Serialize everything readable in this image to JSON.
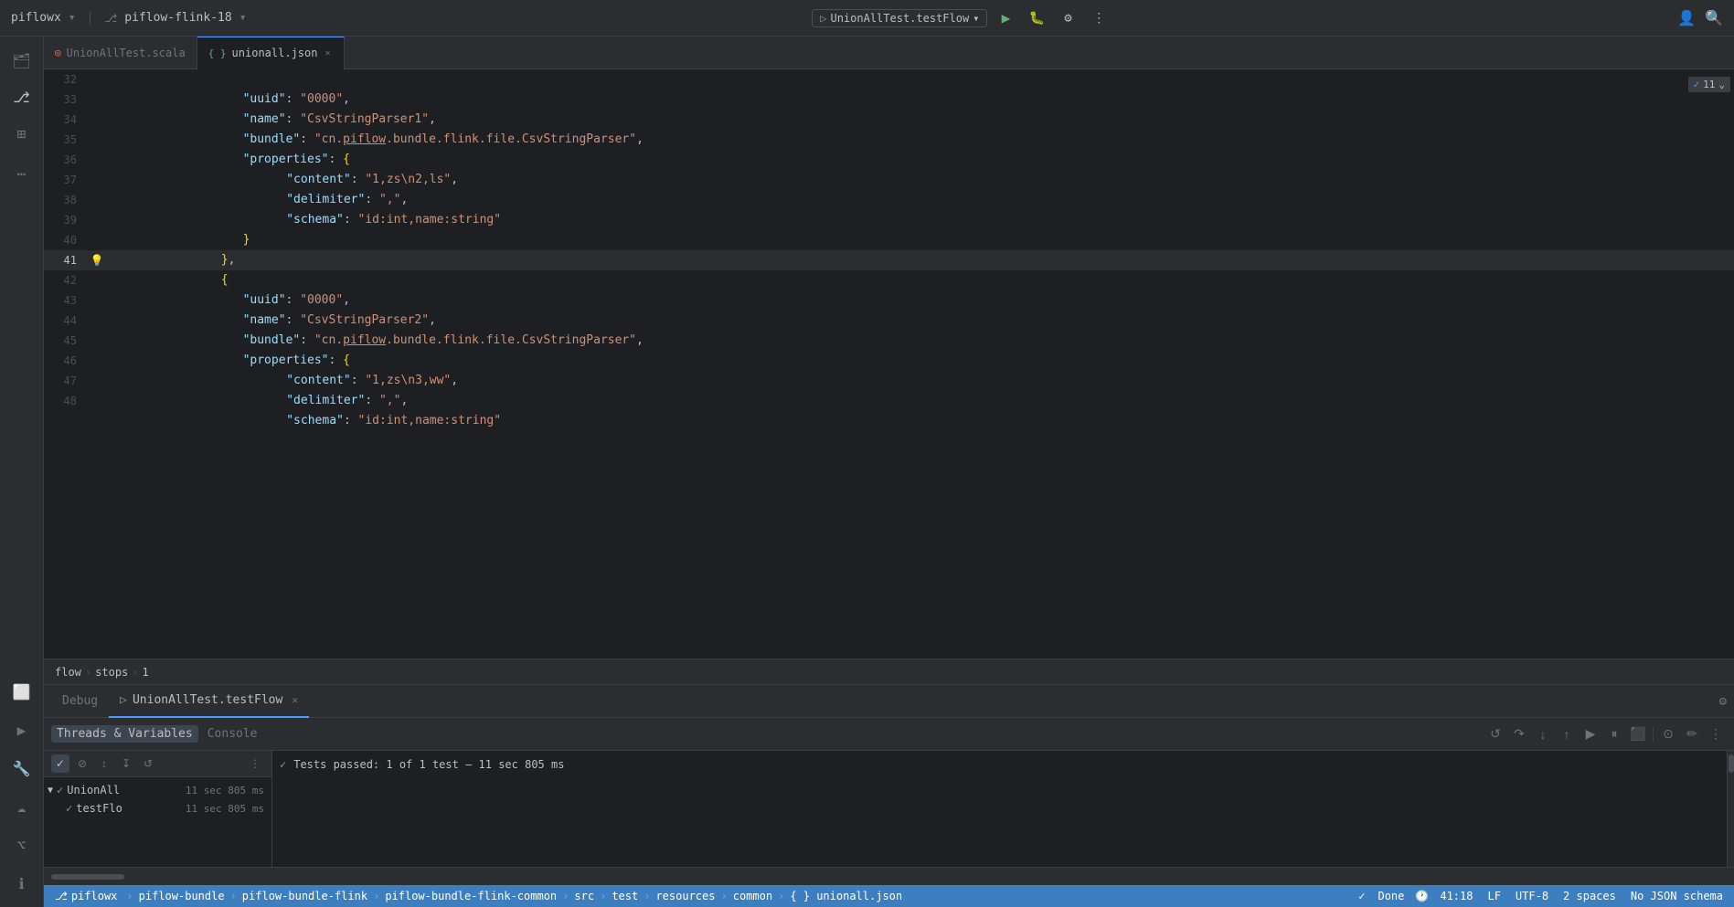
{
  "titleBar": {
    "projectName": "piflowx",
    "branchName": "piflow-flink-18",
    "runConfig": "UnionAllTest.testFlow",
    "chevron": "▾"
  },
  "tabs": [
    {
      "id": "unionalltest-scala",
      "icon": "◎",
      "label": "UnionAllTest.scala",
      "closable": false,
      "active": false
    },
    {
      "id": "unionall-json",
      "icon": "{ }",
      "label": "unionall.json",
      "closable": true,
      "active": true
    }
  ],
  "editor": {
    "scrollIndicator": "11",
    "lines": [
      {
        "num": 32,
        "gutter": "",
        "content": "  \"uuid\": \"0000\","
      },
      {
        "num": 33,
        "gutter": "",
        "content": "  \"name\": \"CsvStringParser1\","
      },
      {
        "num": 34,
        "gutter": "",
        "content": "  \"bundle\": \"cn.piflow.bundle.flink.file.CsvStringParser\","
      },
      {
        "num": 35,
        "gutter": "",
        "content": "  \"properties\": {"
      },
      {
        "num": 36,
        "gutter": "",
        "content": "    \"content\": \"1,zs\\n2,ls\","
      },
      {
        "num": 37,
        "gutter": "",
        "content": "    \"delimiter\": \",\","
      },
      {
        "num": 38,
        "gutter": "",
        "content": "    \"schema\": \"id:int,name:string\""
      },
      {
        "num": 39,
        "gutter": "",
        "content": "  }"
      },
      {
        "num": 40,
        "gutter": "",
        "content": "},"
      },
      {
        "num": 41,
        "gutter": "💡",
        "content": "{"
      },
      {
        "num": 42,
        "gutter": "",
        "content": "  \"uuid\": \"0000\","
      },
      {
        "num": 43,
        "gutter": "",
        "content": "  \"name\": \"CsvStringParser2\","
      },
      {
        "num": 44,
        "gutter": "",
        "content": "  \"bundle\": \"cn.piflow.bundle.flink.file.CsvStringParser\","
      },
      {
        "num": 45,
        "gutter": "",
        "content": "  \"properties\": {"
      },
      {
        "num": 46,
        "gutter": "",
        "content": "    \"content\": \"1,zs\\n3,ww\","
      },
      {
        "num": 47,
        "gutter": "",
        "content": "    \"delimiter\": \",\","
      },
      {
        "num": 48,
        "gutter": "",
        "content": "    \"schema\": \"id:int,name:string\""
      }
    ]
  },
  "breadcrumb": {
    "parts": [
      "flow",
      "stops",
      "1"
    ]
  },
  "debugPanel": {
    "tabs": [
      {
        "id": "debug",
        "label": "Debug",
        "active": false
      },
      {
        "id": "unionalltest-testflow",
        "icon": "▷",
        "label": "UnionAllTest.testFlow",
        "closable": true,
        "active": true
      }
    ],
    "toolbar": {
      "buttons": [
        {
          "id": "check",
          "icon": "✓",
          "tooltip": "Show Passed"
        },
        {
          "id": "cancel",
          "icon": "⊘",
          "tooltip": "Show Ignored"
        },
        {
          "id": "sort-duration",
          "icon": "↕",
          "tooltip": "Sort by Duration"
        },
        {
          "id": "sort-name",
          "icon": "↧",
          "tooltip": "Sort Alphabetically"
        },
        {
          "id": "restart",
          "icon": "↺",
          "tooltip": "Restart"
        },
        {
          "id": "more",
          "icon": "⋯",
          "tooltip": "More"
        }
      ]
    },
    "resultBar": {
      "icon": "✓",
      "text": "Tests passed: 1 of 1 test – 11 sec 805 ms"
    },
    "testItems": [
      {
        "id": "unionall-suite",
        "passIcon": "✓",
        "expanded": true,
        "name": "UnionAll",
        "duration": "11 sec 805 ms",
        "children": [
          {
            "id": "testflow",
            "passIcon": "✓",
            "name": "testFlo",
            "duration": "11 sec 805 ms"
          }
        ]
      }
    ]
  },
  "statusBar": {
    "branch": "piflowx",
    "breadcrumb": [
      "piflowx",
      "piflow-bundle",
      "piflow-bundle-flink",
      "piflow-bundle-flink-common",
      "src",
      "test",
      "resources",
      "common",
      "{ } unionall.json"
    ],
    "right": {
      "done": "Done",
      "position": "41:18",
      "lineEnding": "LF",
      "encoding": "UTF-8",
      "indent": "2 spaces",
      "schema": "No JSON schema"
    }
  },
  "sidebarIcons": [
    {
      "id": "folder",
      "icon": "📁"
    },
    {
      "id": "git",
      "icon": "⎇"
    },
    {
      "id": "structure",
      "icon": "⊞"
    },
    {
      "id": "more-tools",
      "icon": "…"
    }
  ],
  "bottomSidebarIcons": [
    {
      "id": "terminal",
      "icon": "⬛"
    },
    {
      "id": "run",
      "icon": "▶"
    },
    {
      "id": "debug-sidebar",
      "icon": "🐛"
    },
    {
      "id": "services",
      "icon": "☁"
    },
    {
      "id": "git-bottom",
      "icon": "⌥"
    },
    {
      "id": "info",
      "icon": "ℹ"
    }
  ],
  "threadsVariablesLabel": "Threads & Variables",
  "consoleLabel": "Console"
}
